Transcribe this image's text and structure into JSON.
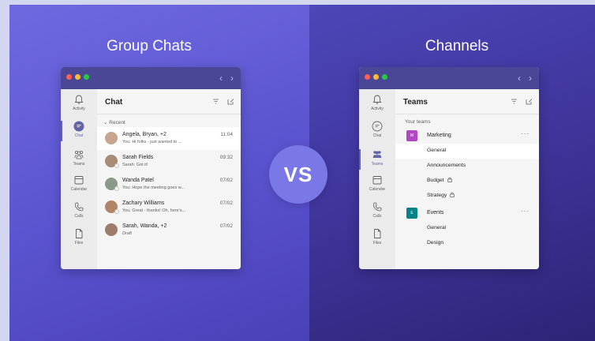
{
  "left": {
    "title": "Group Chats",
    "rail": [
      {
        "label": "Activity",
        "icon": "bell-icon"
      },
      {
        "label": "Chat",
        "icon": "chat-icon"
      },
      {
        "label": "Teams",
        "icon": "teams-icon"
      },
      {
        "label": "Calendar",
        "icon": "calendar-icon"
      },
      {
        "label": "Calls",
        "icon": "phone-icon"
      },
      {
        "label": "Files",
        "icon": "file-icon"
      }
    ],
    "pane_title": "Chat",
    "section": "Recent",
    "chats": [
      {
        "name": "Angela, Bryan, +2",
        "time": "11:04",
        "preview": "You: Hi folks - just wanted to ..."
      },
      {
        "name": "Sarah Fields",
        "time": "09:32",
        "preview": "Sarah: Got it!"
      },
      {
        "name": "Wanda Patel",
        "time": "07/02",
        "preview": "You: Hope the meeting goes w..."
      },
      {
        "name": "Zachary Williams",
        "time": "07/02",
        "preview": "You: Great - thanks! Oh, here's..."
      },
      {
        "name": "Sarah, Wanda, +2",
        "time": "07/02",
        "preview": "Draft"
      }
    ]
  },
  "vs": "VS",
  "right": {
    "title": "Channels",
    "pane_title": "Teams",
    "section": "Your teams",
    "teams": [
      {
        "name": "Marketing",
        "initial": "M",
        "color": "#b146c2",
        "channels": [
          "General",
          "Announcements",
          "Budget",
          "Strategy"
        ]
      },
      {
        "name": "Events",
        "initial": "E",
        "color": "#038387",
        "channels": [
          "General",
          "Design"
        ]
      }
    ]
  },
  "colors": {
    "brand": "#6264a7",
    "titlebar": "#4b4797"
  }
}
